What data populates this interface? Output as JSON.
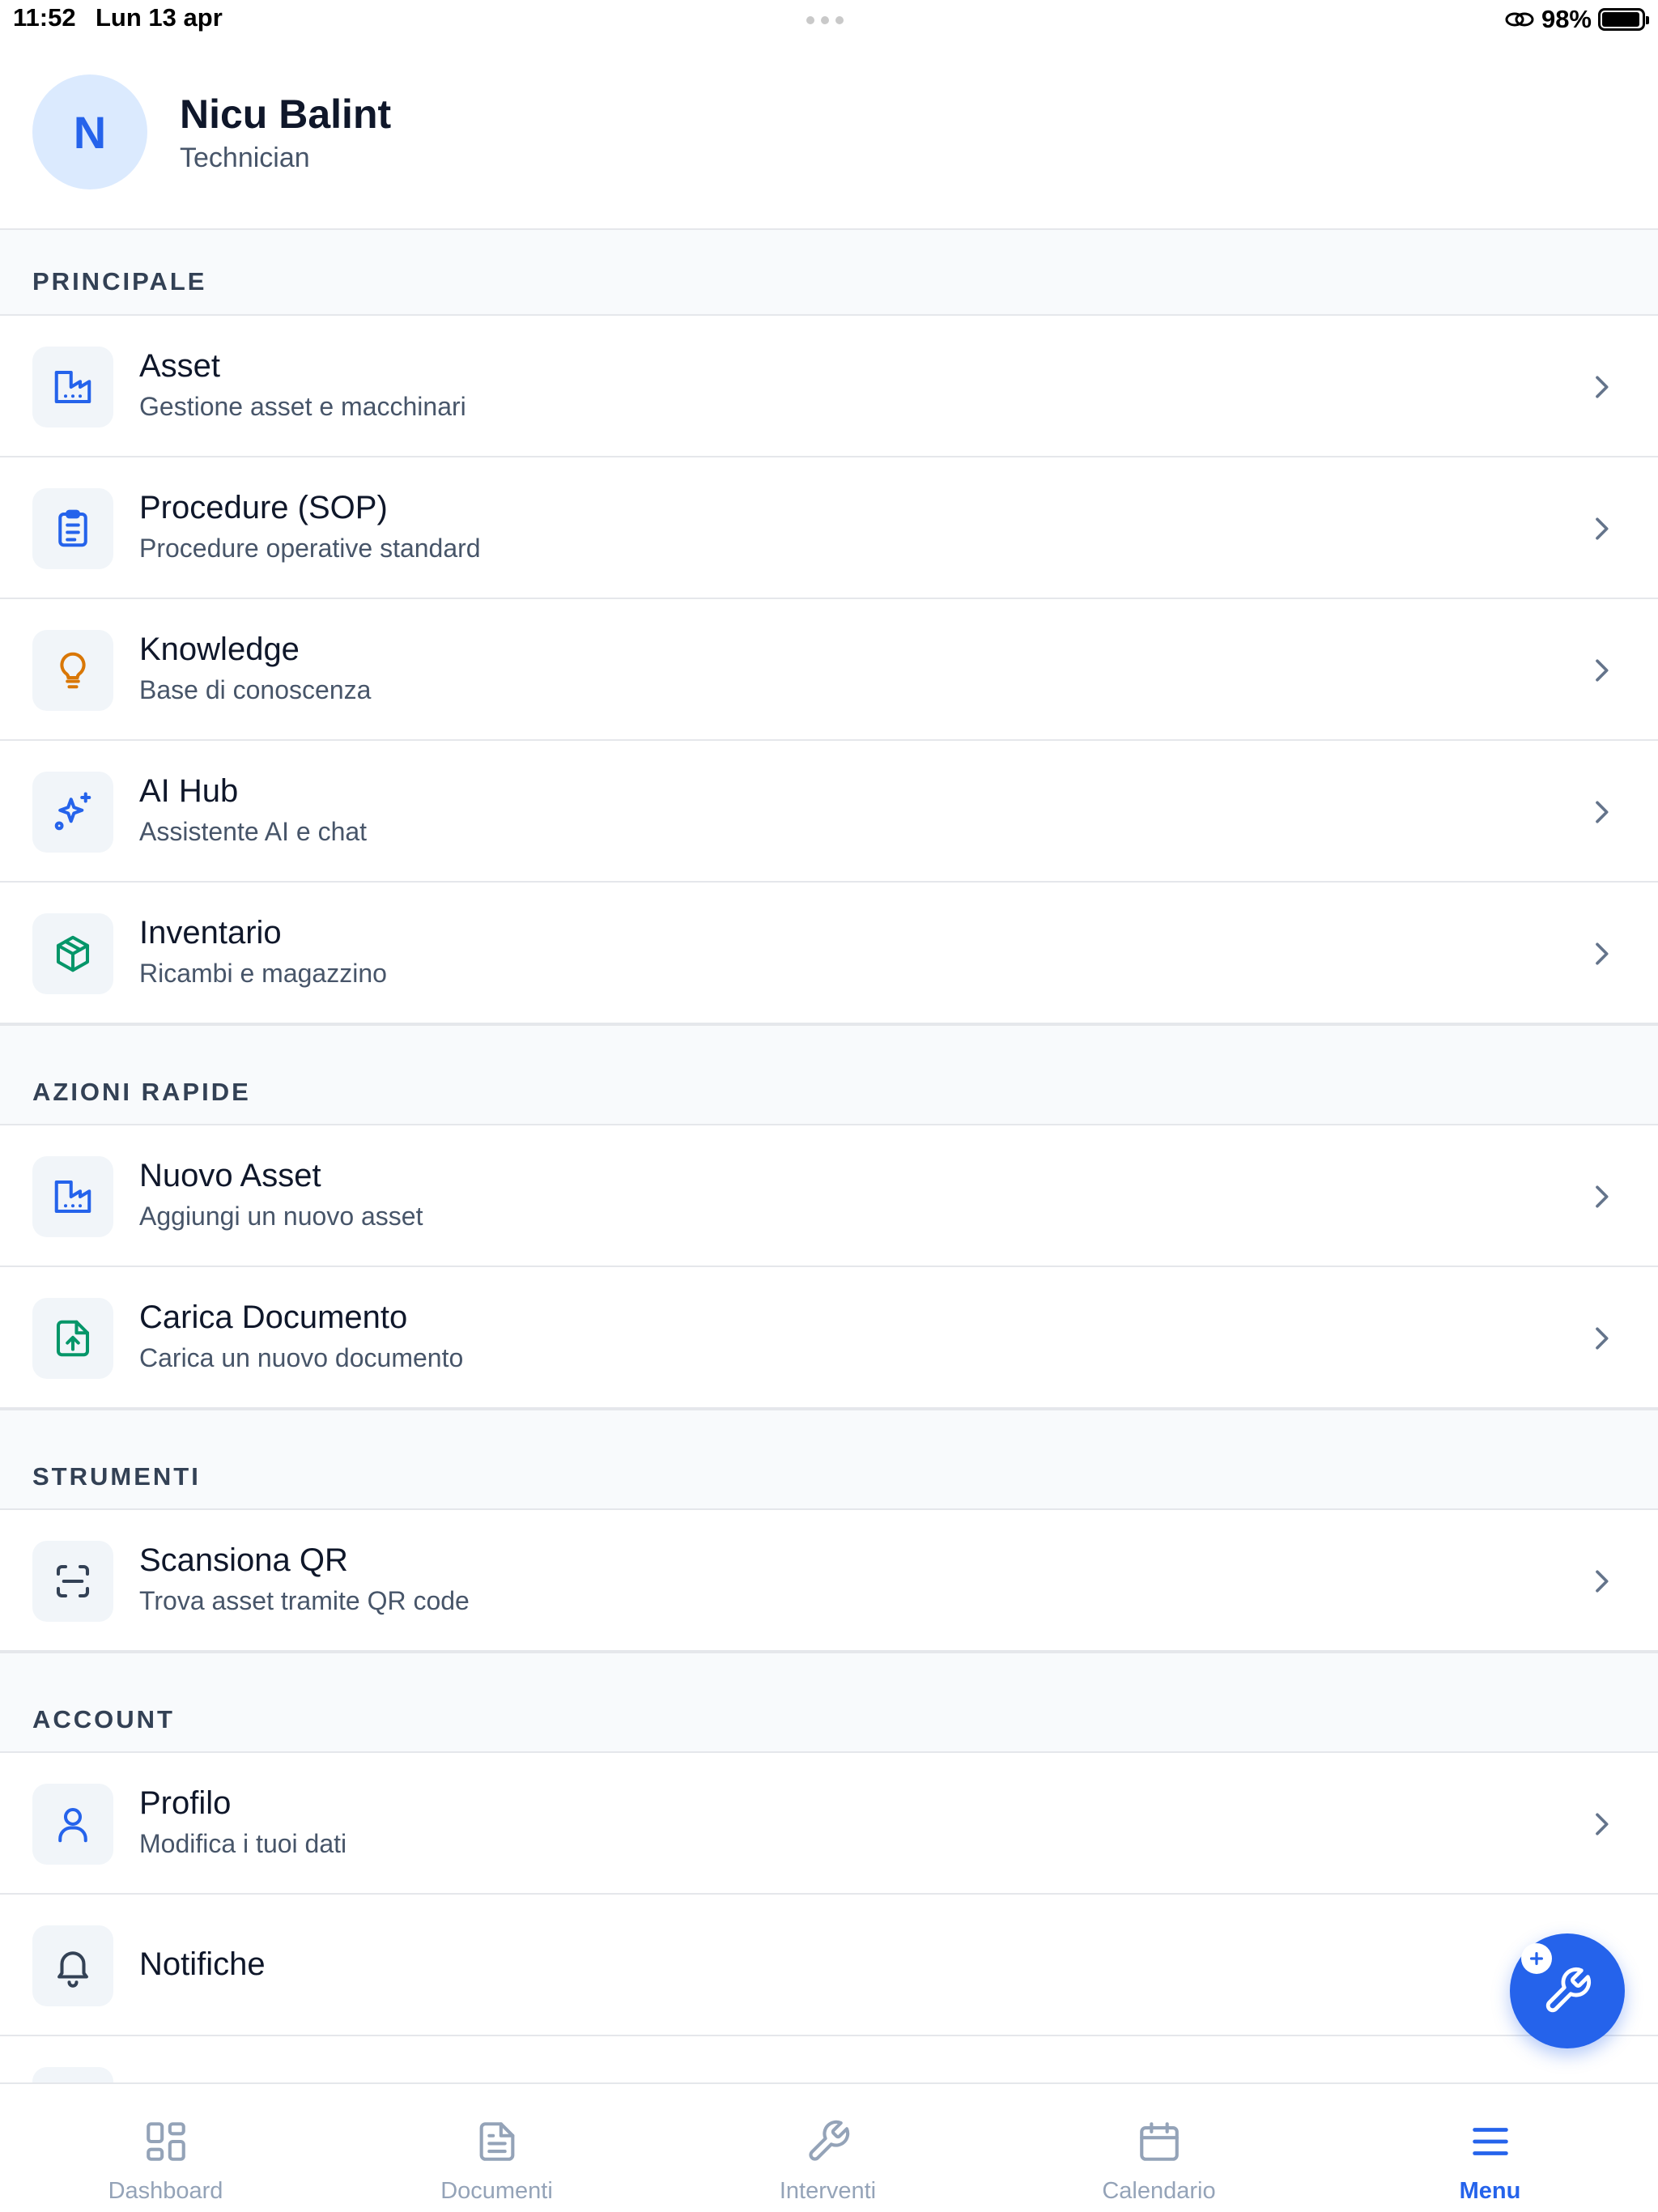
{
  "status_bar": {
    "time": "11:52",
    "date": "Lun 13 apr",
    "battery": "98%"
  },
  "user": {
    "initial": "N",
    "name": "Nicu Balint",
    "role": "Technician"
  },
  "sections": {
    "principale": {
      "title": "PRINCIPALE",
      "items": [
        {
          "title": "Asset",
          "subtitle": "Gestione asset e macchinari",
          "icon": "factory-icon"
        },
        {
          "title": "Procedure (SOP)",
          "subtitle": "Procedure operative standard",
          "icon": "clipboard-icon"
        },
        {
          "title": "Knowledge",
          "subtitle": "Base di conoscenza",
          "icon": "lightbulb-icon"
        },
        {
          "title": "AI Hub",
          "subtitle": "Assistente AI e chat",
          "icon": "sparkles-icon"
        },
        {
          "title": "Inventario",
          "subtitle": "Ricambi e magazzino",
          "icon": "package-icon"
        }
      ]
    },
    "azioni_rapide": {
      "title": "AZIONI RAPIDE",
      "items": [
        {
          "title": "Nuovo Asset",
          "subtitle": "Aggiungi un nuovo asset",
          "icon": "factory-icon"
        },
        {
          "title": "Carica Documento",
          "subtitle": "Carica un nuovo documento",
          "icon": "file-upload-icon"
        }
      ]
    },
    "strumenti": {
      "title": "STRUMENTI",
      "items": [
        {
          "title": "Scansiona QR",
          "subtitle": "Trova asset tramite QR code",
          "icon": "scan-icon"
        }
      ]
    },
    "account": {
      "title": "ACCOUNT",
      "items": [
        {
          "title": "Profilo",
          "subtitle": "Modifica i tuoi dati",
          "icon": "user-icon"
        },
        {
          "title": "Notifiche",
          "icon": "bell-icon"
        }
      ]
    }
  },
  "fab": {
    "icon": "wrench-plus-icon"
  },
  "tabbar": {
    "tabs": [
      {
        "label": "Dashboard",
        "icon": "grid-icon"
      },
      {
        "label": "Documenti",
        "icon": "document-icon"
      },
      {
        "label": "Interventi",
        "icon": "wrench-icon"
      },
      {
        "label": "Calendario",
        "icon": "calendar-icon"
      },
      {
        "label": "Menu",
        "icon": "menu-icon",
        "active": true
      }
    ]
  },
  "colors": {
    "accent": "#2563eb",
    "orange": "#d97706",
    "green": "#059669",
    "section_bg": "#f8fafc"
  }
}
